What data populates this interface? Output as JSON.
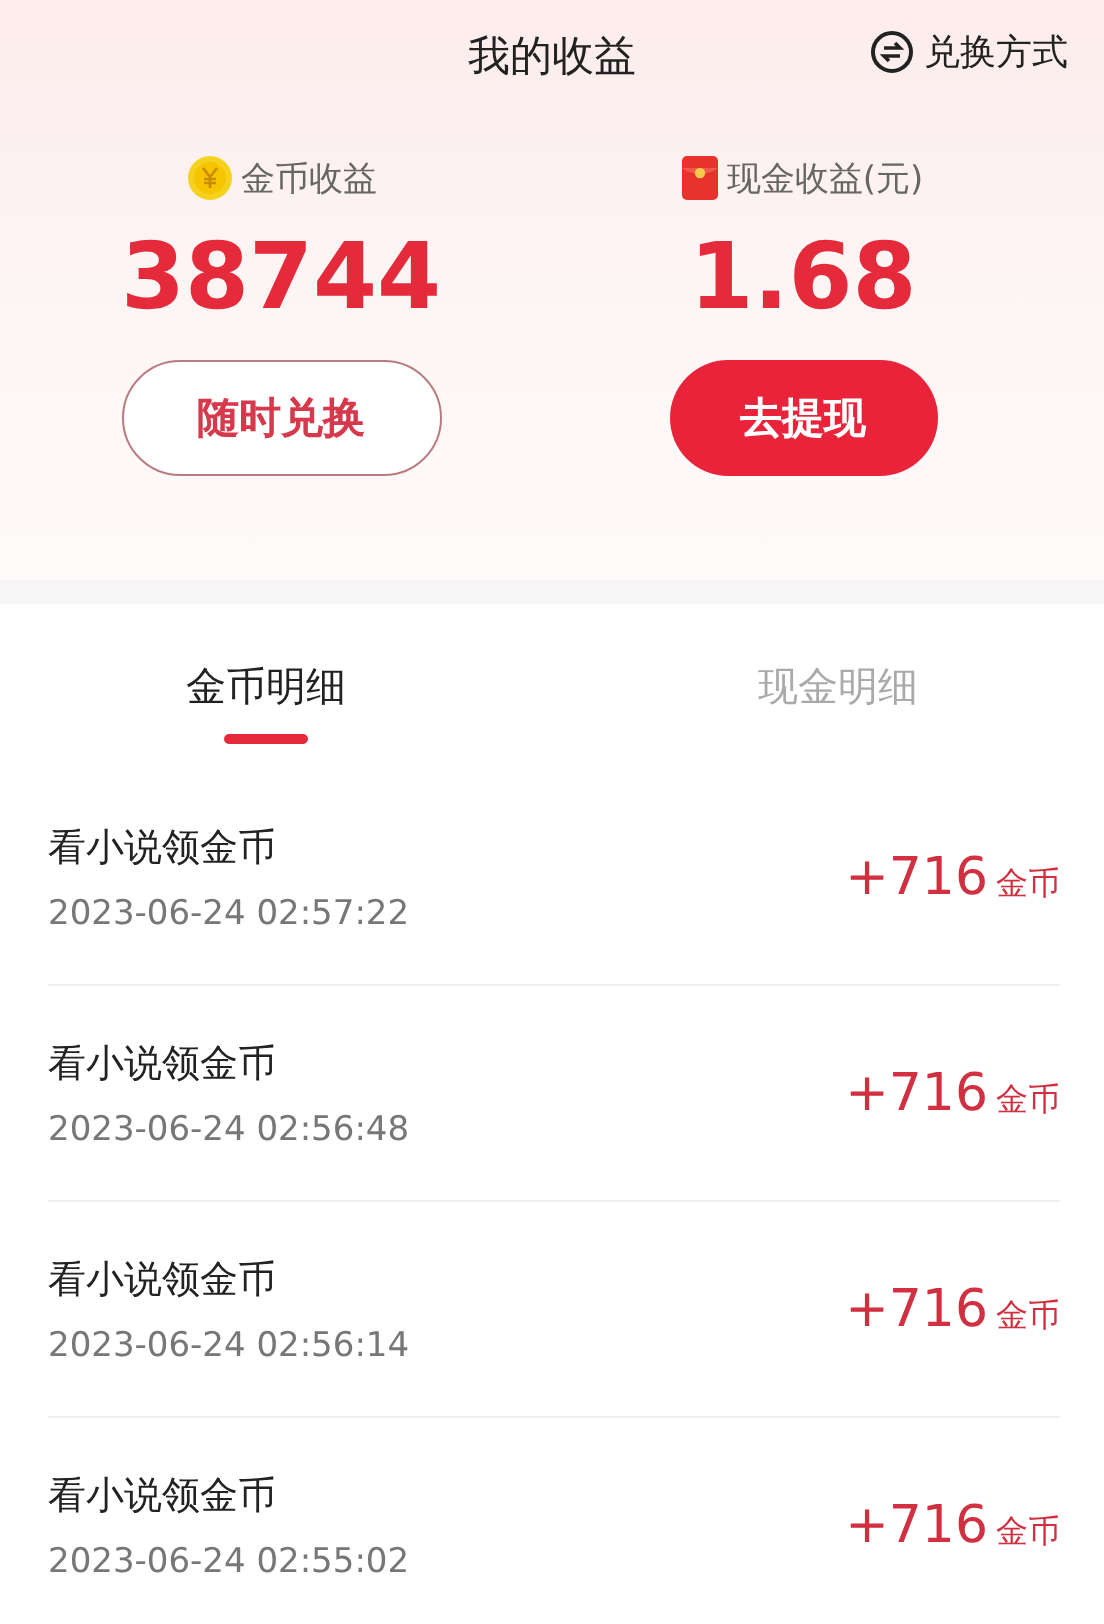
{
  "header": {
    "title": "我的收益",
    "exchange_link": "兑换方式"
  },
  "balances": [
    {
      "kind": "coin",
      "label": "金币收益",
      "amount": "38744",
      "button": "随时兑换"
    },
    {
      "kind": "cash",
      "label": "现金收益(元)",
      "amount": "1.68",
      "button": "去提现"
    }
  ],
  "tabs": [
    {
      "label": "金币明细",
      "selected": true
    },
    {
      "label": "现金明细",
      "selected": false
    }
  ],
  "records": [
    {
      "title": "看小说领金币",
      "time": "2023-06-24 02:57:22",
      "amount": "+716",
      "unit": "金币"
    },
    {
      "title": "看小说领金币",
      "time": "2023-06-24 02:56:48",
      "amount": "+716",
      "unit": "金币"
    },
    {
      "title": "看小说领金币",
      "time": "2023-06-24 02:56:14",
      "amount": "+716",
      "unit": "金币"
    },
    {
      "title": "看小说领金币",
      "time": "2023-06-24 02:55:02",
      "amount": "+716",
      "unit": "金币"
    }
  ]
}
